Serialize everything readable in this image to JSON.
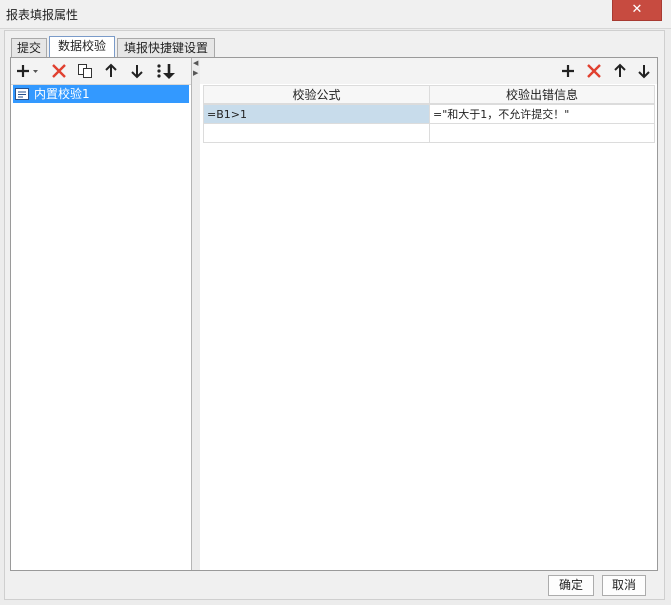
{
  "window": {
    "title": "报表填报属性",
    "close_label": "✕"
  },
  "tabs": [
    {
      "label": "提交"
    },
    {
      "label": "数据校验"
    },
    {
      "label": "填报快捷键设置"
    }
  ],
  "left_pane": {
    "toolbar": [
      "add-icon",
      "delete-icon",
      "copy-icon",
      "move-up-icon",
      "move-down-icon",
      "move-bottom-icon"
    ],
    "items": [
      {
        "label": "内置校验1",
        "selected": true
      }
    ]
  },
  "right_pane": {
    "toolbar": [
      "add-icon",
      "delete-icon",
      "move-up-icon",
      "move-down-icon"
    ],
    "columns": [
      "校验公式",
      "校验出错信息"
    ],
    "rows": [
      {
        "formula": "=B1>1",
        "message": "=\"和大于1，不允许提交！\""
      },
      {
        "formula": "",
        "message": ""
      }
    ]
  },
  "footer": {
    "ok_label": "确定",
    "cancel_label": "取消"
  },
  "colors": {
    "accent": "#3399ff",
    "delete": "#e0402f",
    "selected_cell": "#c8dceb",
    "close": "#c74b40"
  }
}
